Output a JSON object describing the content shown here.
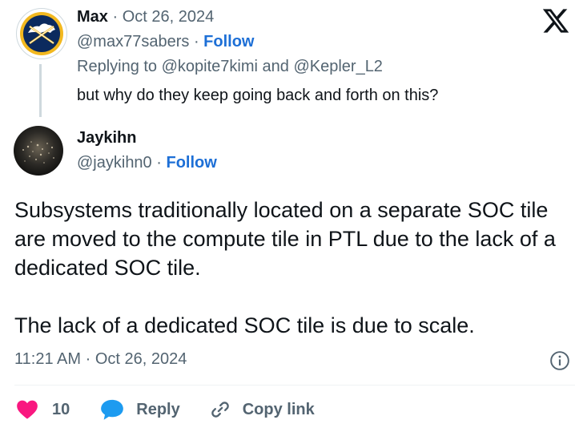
{
  "parent_tweet": {
    "author_name": "Max",
    "date": "Oct 26, 2024",
    "handle": "@max77sabers",
    "follow_label": "Follow",
    "replying_prefix": "Replying to",
    "replying_to": "@kopite7kimi and @Kepler_L2",
    "text": "but why do they keep going back and forth on this?",
    "avatar_icon": "sabres-logo-icon"
  },
  "main_tweet": {
    "author_name": "Jaykihn",
    "handle": "@jaykihn0",
    "follow_label": "Follow",
    "paragraph_1": "Subsystems traditionally located on a separate SOC tile are moved to the compute tile in PTL due to the lack of a dedicated SOC tile.",
    "paragraph_2": "The lack of a dedicated SOC tile is due to scale.",
    "time": "11:21 AM",
    "date": "Oct 26, 2024",
    "avatar_icon": "night-city-avatar"
  },
  "actions": {
    "like_count": "10",
    "reply_label": "Reply",
    "copy_link_label": "Copy link"
  },
  "colors": {
    "link_blue": "#1d6fd6",
    "like_red": "#f91880",
    "reply_blue": "#1d9bf0",
    "muted": "#536471",
    "thread_line": "#cfd9de"
  },
  "separator": "·"
}
